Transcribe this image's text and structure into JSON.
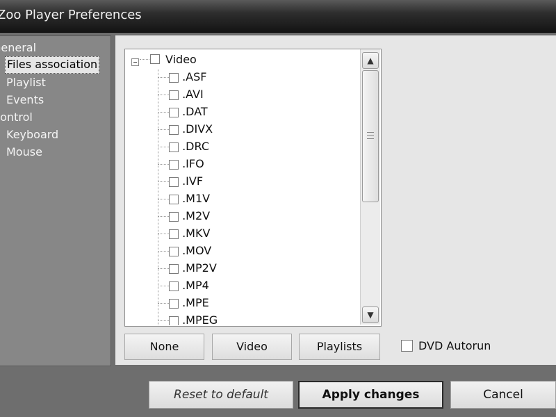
{
  "window": {
    "title": "Zoo Player Preferences"
  },
  "sidebar": {
    "items": [
      {
        "label": "General"
      },
      {
        "label": "Files association",
        "selected": true
      },
      {
        "label": "Playlist"
      },
      {
        "label": "Events"
      },
      {
        "label": "Control"
      },
      {
        "label": "Keyboard"
      },
      {
        "label": "Mouse"
      }
    ]
  },
  "tree": {
    "root": {
      "label": "Video",
      "checked": false,
      "expanded": true
    },
    "children": [
      {
        "label": ".ASF",
        "checked": false
      },
      {
        "label": ".AVI",
        "checked": false
      },
      {
        "label": ".DAT",
        "checked": false
      },
      {
        "label": ".DIVX",
        "checked": false
      },
      {
        "label": ".DRC",
        "checked": false
      },
      {
        "label": ".IFO",
        "checked": false
      },
      {
        "label": ".IVF",
        "checked": false
      },
      {
        "label": ".M1V",
        "checked": false
      },
      {
        "label": ".M2V",
        "checked": false
      },
      {
        "label": ".MKV",
        "checked": false
      },
      {
        "label": ".MOV",
        "checked": false
      },
      {
        "label": ".MP2V",
        "checked": false
      },
      {
        "label": ".MP4",
        "checked": false
      },
      {
        "label": ".MPE",
        "checked": false
      },
      {
        "label": ".MPEG",
        "checked": false
      }
    ]
  },
  "buttons": {
    "none": "None",
    "video": "Video",
    "playlists": "Playlists",
    "dvd_autorun": "DVD Autorun",
    "dvd_autorun_checked": false
  },
  "footer": {
    "reset": "Reset to default",
    "apply": "Apply changes",
    "cancel": "Cancel"
  },
  "icons": {
    "expander": "minus-box-icon",
    "scroll_up": "chevron-up-icon",
    "scroll_down": "chevron-down-icon"
  }
}
